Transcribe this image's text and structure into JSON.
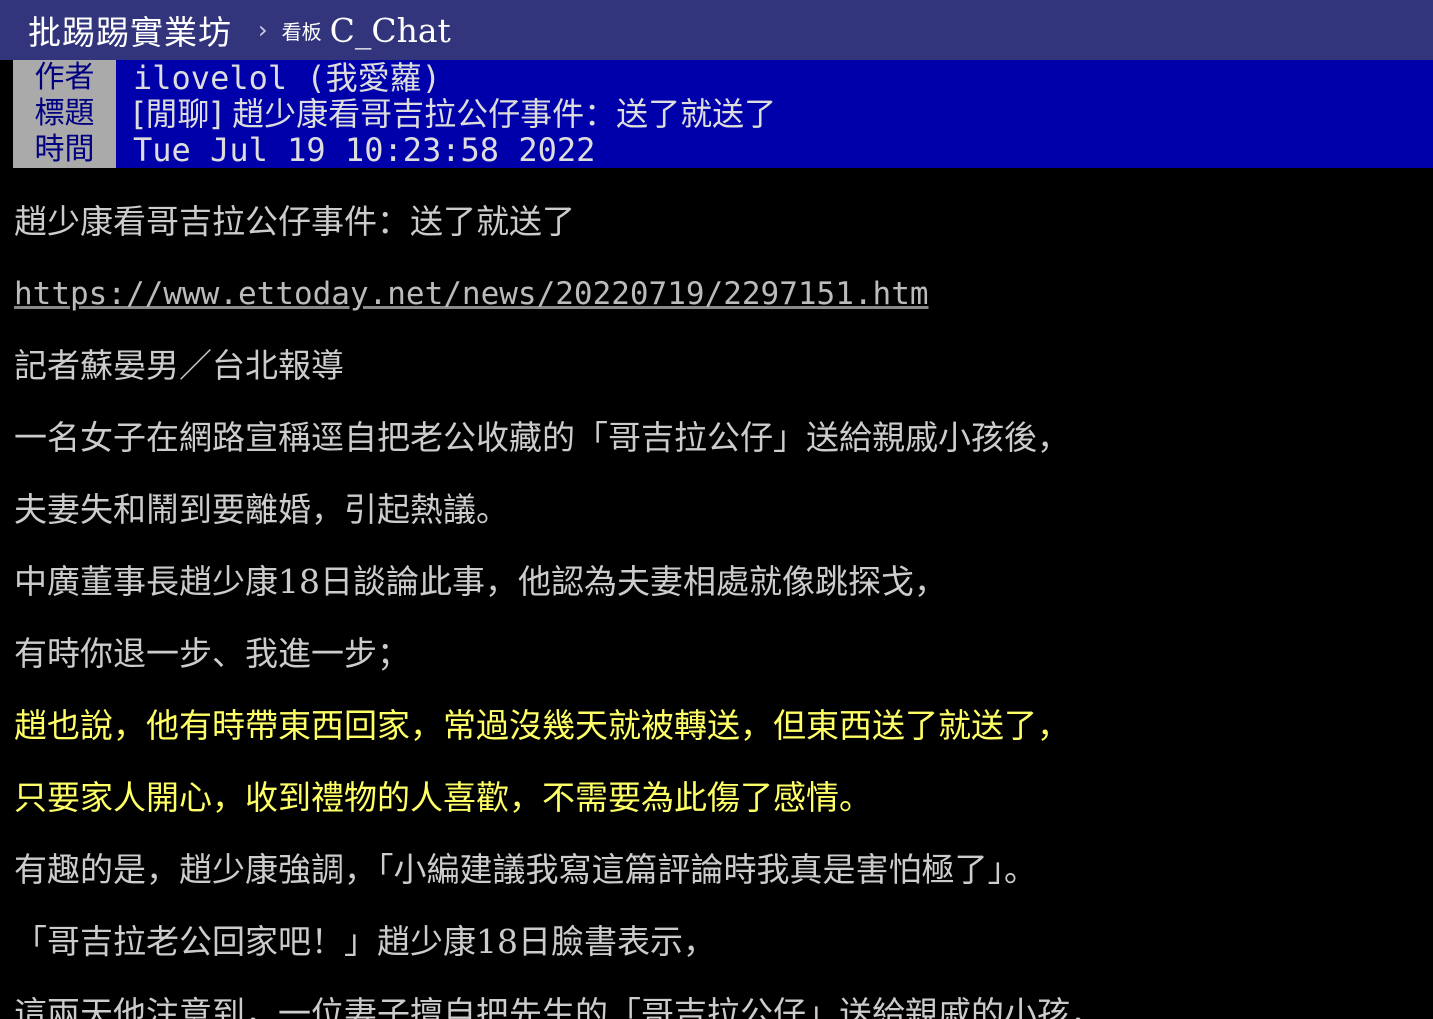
{
  "header": {
    "site_name": "批踢踢實業坊",
    "separator": "›",
    "board_label": "看板",
    "board_name": "C_Chat"
  },
  "meta": {
    "author_label": "作者",
    "author": "ilovelol (我愛蘿)",
    "title_label": "標題",
    "title": "[閒聊] 趙少康看哥吉拉公仔事件：送了就送了",
    "time_label": "時間",
    "time": "Tue Jul 19 10:23:58 2022"
  },
  "content": {
    "lines": [
      "趙少康看哥吉拉公仔事件：送了就送了",
      "https://www.ettoday.net/news/20220719/2297151.htm",
      "記者蘇晏男／台北報導",
      "一名女子在網路宣稱逕自把老公收藏的「哥吉拉公仔」送給親戚小孩後，",
      "夫妻失和鬧到要離婚，引起熱議。",
      "中廣董事長趙少康18日談論此事，他認為夫妻相處就像跳探戈，",
      "有時你退一步、我進一步；",
      "趙也說，他有時帶東西回家，常過沒幾天就被轉送，但東西送了就送了，",
      "只要家人開心，收到禮物的人喜歡，不需要為此傷了感情。",
      "有趣的是，趙少康強調，「小編建議我寫這篇評論時我真是害怕極了」。",
      "「哥吉拉老公回家吧！」趙少康18日臉書表示，",
      "這兩天他注意到，一位妻子擅自把先生的「哥吉拉公仔」送給親戚的小孩，"
    ]
  },
  "colors": {
    "header_bg": "#32347c",
    "meta_key_bg": "#aaaaaa",
    "meta_val_bg": "#0000aa",
    "highlight_text": "#ffff66"
  }
}
